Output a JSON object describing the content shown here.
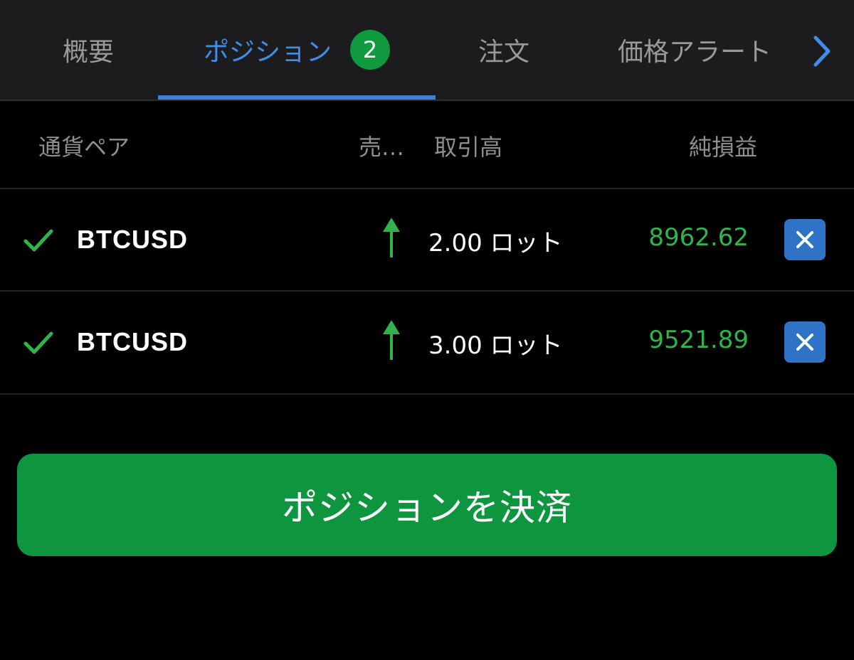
{
  "tabs": {
    "overview": "概要",
    "positions": "ポジション",
    "positions_count": "2",
    "orders": "注文",
    "alerts": "価格アラート"
  },
  "columns": {
    "pair": "通貨ペア",
    "side": "売…",
    "volume": "取引高",
    "pnl": "純損益"
  },
  "positions": [
    {
      "symbol": "BTCUSD",
      "side": "buy",
      "volume": "2.00 ロット",
      "pnl": "8962.62"
    },
    {
      "symbol": "BTCUSD",
      "side": "buy",
      "volume": "3.00 ロット",
      "pnl": "9521.89"
    }
  ],
  "close_button": "ポジションを決済",
  "colors": {
    "accent_blue": "#3f8fe8",
    "profit_green": "#2fb44c",
    "button_green": "#0e963f",
    "close_blue": "#2f73c6"
  },
  "icons": {
    "check": "check-icon",
    "buy_arrow": "arrow-up-icon",
    "close": "close-icon",
    "next": "chevron-right-icon"
  }
}
